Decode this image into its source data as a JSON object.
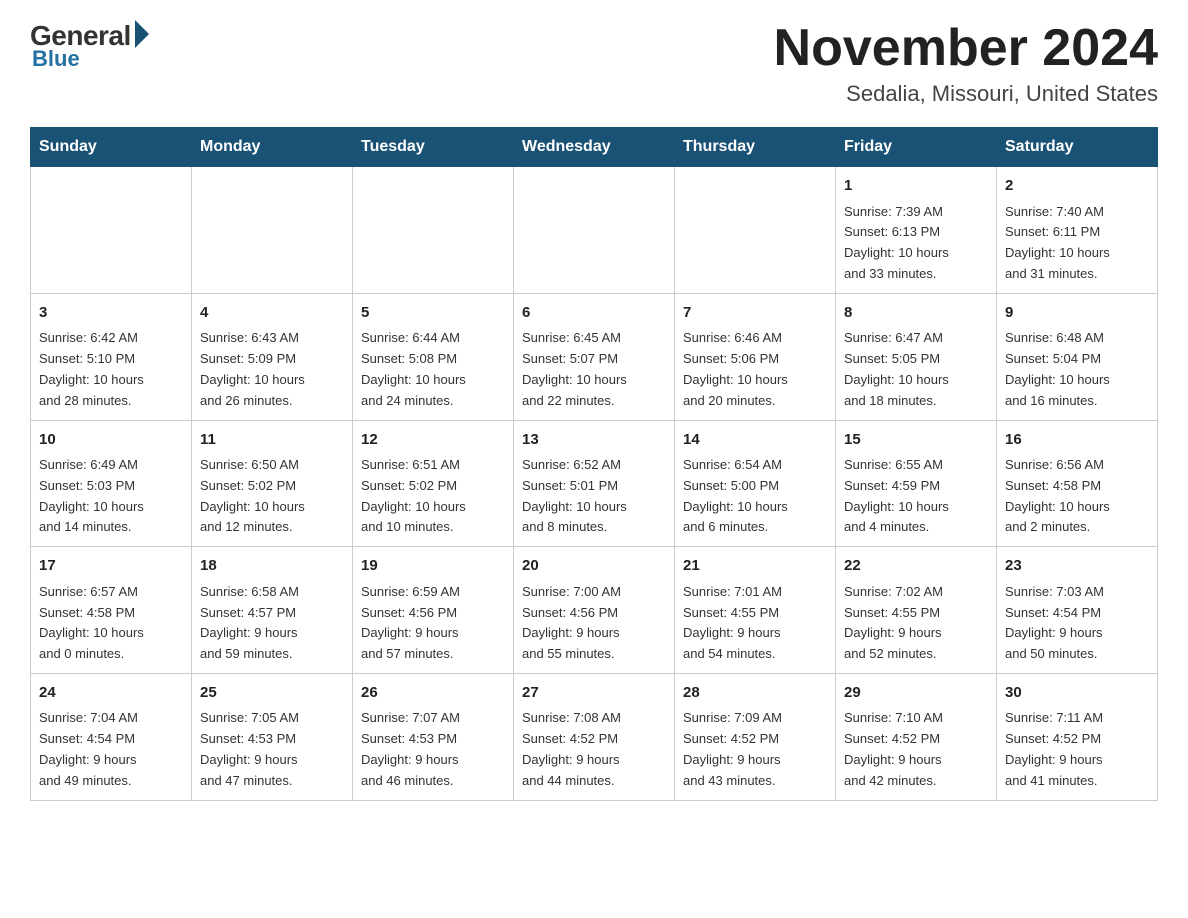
{
  "header": {
    "logo_general": "General",
    "logo_blue": "Blue",
    "title": "November 2024",
    "subtitle": "Sedalia, Missouri, United States"
  },
  "calendar": {
    "weekdays": [
      "Sunday",
      "Monday",
      "Tuesday",
      "Wednesday",
      "Thursday",
      "Friday",
      "Saturday"
    ],
    "weeks": [
      [
        {
          "day": "",
          "info": ""
        },
        {
          "day": "",
          "info": ""
        },
        {
          "day": "",
          "info": ""
        },
        {
          "day": "",
          "info": ""
        },
        {
          "day": "",
          "info": ""
        },
        {
          "day": "1",
          "info": "Sunrise: 7:39 AM\nSunset: 6:13 PM\nDaylight: 10 hours\nand 33 minutes."
        },
        {
          "day": "2",
          "info": "Sunrise: 7:40 AM\nSunset: 6:11 PM\nDaylight: 10 hours\nand 31 minutes."
        }
      ],
      [
        {
          "day": "3",
          "info": "Sunrise: 6:42 AM\nSunset: 5:10 PM\nDaylight: 10 hours\nand 28 minutes."
        },
        {
          "day": "4",
          "info": "Sunrise: 6:43 AM\nSunset: 5:09 PM\nDaylight: 10 hours\nand 26 minutes."
        },
        {
          "day": "5",
          "info": "Sunrise: 6:44 AM\nSunset: 5:08 PM\nDaylight: 10 hours\nand 24 minutes."
        },
        {
          "day": "6",
          "info": "Sunrise: 6:45 AM\nSunset: 5:07 PM\nDaylight: 10 hours\nand 22 minutes."
        },
        {
          "day": "7",
          "info": "Sunrise: 6:46 AM\nSunset: 5:06 PM\nDaylight: 10 hours\nand 20 minutes."
        },
        {
          "day": "8",
          "info": "Sunrise: 6:47 AM\nSunset: 5:05 PM\nDaylight: 10 hours\nand 18 minutes."
        },
        {
          "day": "9",
          "info": "Sunrise: 6:48 AM\nSunset: 5:04 PM\nDaylight: 10 hours\nand 16 minutes."
        }
      ],
      [
        {
          "day": "10",
          "info": "Sunrise: 6:49 AM\nSunset: 5:03 PM\nDaylight: 10 hours\nand 14 minutes."
        },
        {
          "day": "11",
          "info": "Sunrise: 6:50 AM\nSunset: 5:02 PM\nDaylight: 10 hours\nand 12 minutes."
        },
        {
          "day": "12",
          "info": "Sunrise: 6:51 AM\nSunset: 5:02 PM\nDaylight: 10 hours\nand 10 minutes."
        },
        {
          "day": "13",
          "info": "Sunrise: 6:52 AM\nSunset: 5:01 PM\nDaylight: 10 hours\nand 8 minutes."
        },
        {
          "day": "14",
          "info": "Sunrise: 6:54 AM\nSunset: 5:00 PM\nDaylight: 10 hours\nand 6 minutes."
        },
        {
          "day": "15",
          "info": "Sunrise: 6:55 AM\nSunset: 4:59 PM\nDaylight: 10 hours\nand 4 minutes."
        },
        {
          "day": "16",
          "info": "Sunrise: 6:56 AM\nSunset: 4:58 PM\nDaylight: 10 hours\nand 2 minutes."
        }
      ],
      [
        {
          "day": "17",
          "info": "Sunrise: 6:57 AM\nSunset: 4:58 PM\nDaylight: 10 hours\nand 0 minutes."
        },
        {
          "day": "18",
          "info": "Sunrise: 6:58 AM\nSunset: 4:57 PM\nDaylight: 9 hours\nand 59 minutes."
        },
        {
          "day": "19",
          "info": "Sunrise: 6:59 AM\nSunset: 4:56 PM\nDaylight: 9 hours\nand 57 minutes."
        },
        {
          "day": "20",
          "info": "Sunrise: 7:00 AM\nSunset: 4:56 PM\nDaylight: 9 hours\nand 55 minutes."
        },
        {
          "day": "21",
          "info": "Sunrise: 7:01 AM\nSunset: 4:55 PM\nDaylight: 9 hours\nand 54 minutes."
        },
        {
          "day": "22",
          "info": "Sunrise: 7:02 AM\nSunset: 4:55 PM\nDaylight: 9 hours\nand 52 minutes."
        },
        {
          "day": "23",
          "info": "Sunrise: 7:03 AM\nSunset: 4:54 PM\nDaylight: 9 hours\nand 50 minutes."
        }
      ],
      [
        {
          "day": "24",
          "info": "Sunrise: 7:04 AM\nSunset: 4:54 PM\nDaylight: 9 hours\nand 49 minutes."
        },
        {
          "day": "25",
          "info": "Sunrise: 7:05 AM\nSunset: 4:53 PM\nDaylight: 9 hours\nand 47 minutes."
        },
        {
          "day": "26",
          "info": "Sunrise: 7:07 AM\nSunset: 4:53 PM\nDaylight: 9 hours\nand 46 minutes."
        },
        {
          "day": "27",
          "info": "Sunrise: 7:08 AM\nSunset: 4:52 PM\nDaylight: 9 hours\nand 44 minutes."
        },
        {
          "day": "28",
          "info": "Sunrise: 7:09 AM\nSunset: 4:52 PM\nDaylight: 9 hours\nand 43 minutes."
        },
        {
          "day": "29",
          "info": "Sunrise: 7:10 AM\nSunset: 4:52 PM\nDaylight: 9 hours\nand 42 minutes."
        },
        {
          "day": "30",
          "info": "Sunrise: 7:11 AM\nSunset: 4:52 PM\nDaylight: 9 hours\nand 41 minutes."
        }
      ]
    ]
  }
}
